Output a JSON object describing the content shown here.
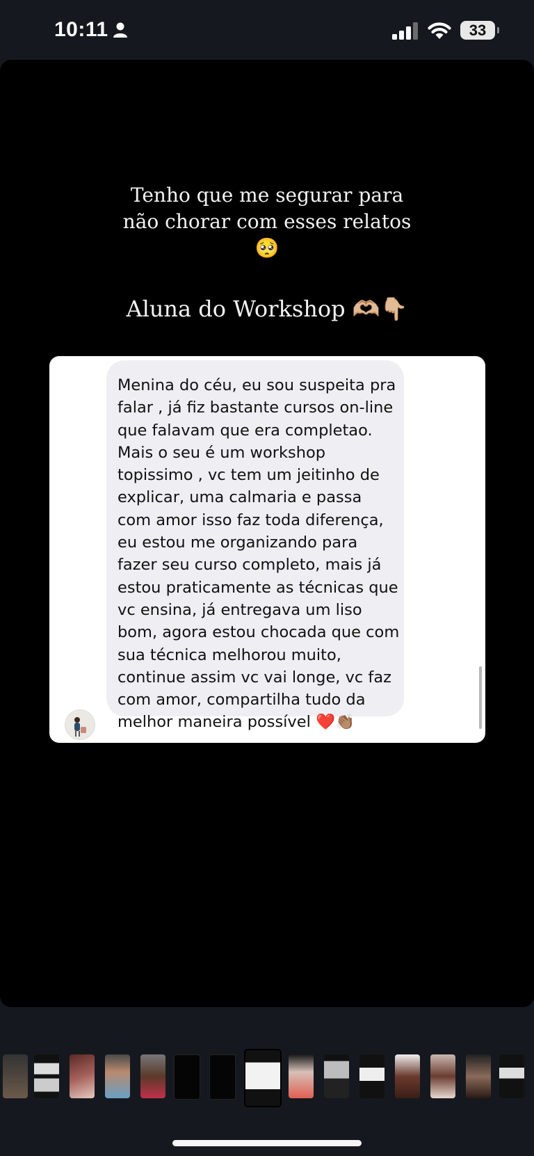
{
  "status_bar": {
    "time": "10:11",
    "battery_level": "33",
    "signal_bars": 3,
    "icons": [
      "person-icon",
      "cellular-signal-icon",
      "wifi-icon",
      "battery-icon"
    ]
  },
  "story": {
    "caption_line_1": "Tenho que me segurar para",
    "caption_line_2": "não chorar com esses relatos",
    "caption_emoji": "🥺",
    "subtitle_text": "Aluna do Workshop",
    "subtitle_emoji": "🫶🏼👇🏼",
    "message": {
      "text": "Menina do céu, eu sou suspeita pra falar , já fiz bastante cursos on-line que falavam que era completao. Mais o seu é um workshop topissimo , vc tem um jeitinho de explicar, uma calmaria e passa com amor isso faz toda diferença, eu estou me organizando para fazer seu curso completo, mais já estou praticamente as técnicas que vc ensina, já entregava um liso bom, agora estou chocada que com sua técnica melhorou muito, continue assim vc vai longe, vc faz com amor, compartilha tudo da melhor maneira possível ❤️👏🏽"
    }
  },
  "thumbnails": {
    "count": 16,
    "active_index": 7
  },
  "colors": {
    "status_background": "#15191f",
    "story_background": "#000000",
    "card_background": "#ffffff",
    "bubble_background": "#efeff3",
    "text_light": "#f3f3f3"
  }
}
